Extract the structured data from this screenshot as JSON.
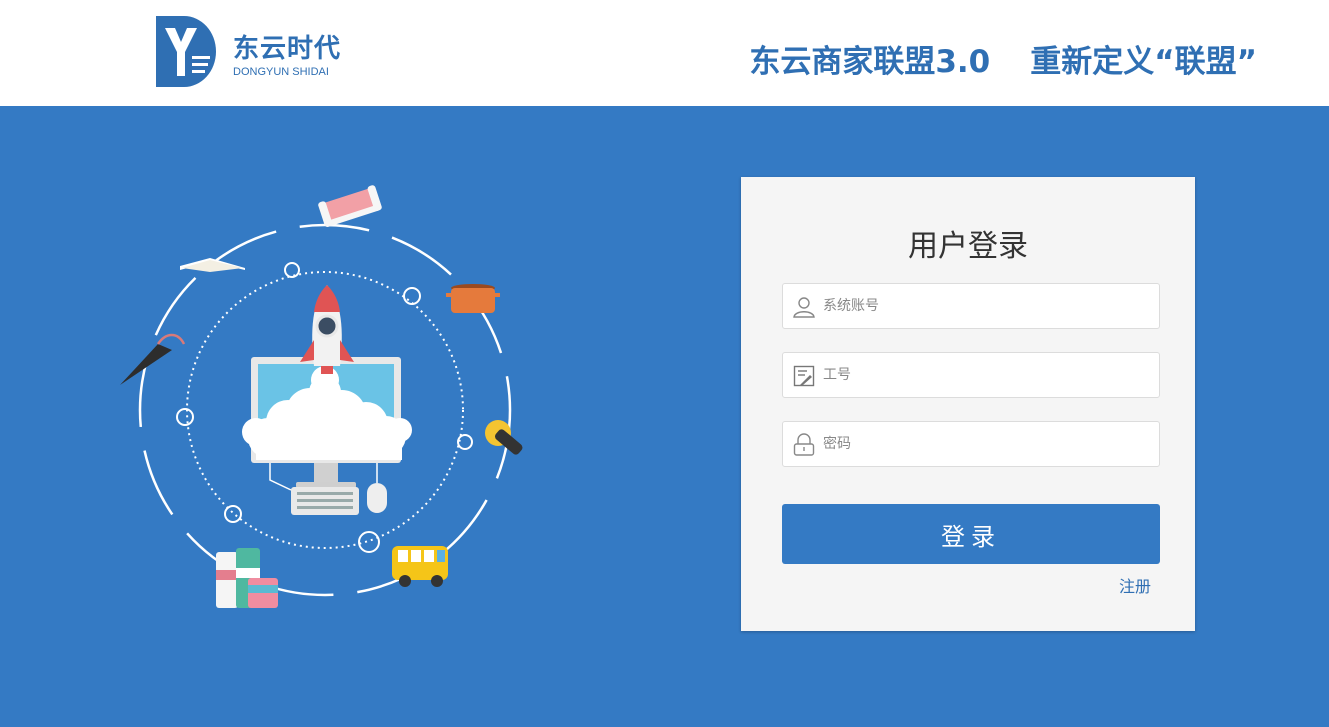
{
  "header": {
    "logo_title": "东云时代",
    "logo_subtitle": "DONGYUN SHIDAI",
    "slogan_part1": "东云商家联盟3.0",
    "slogan_part2": "重新定义“联盟”"
  },
  "login": {
    "title": "用户登录",
    "account_placeholder": "系统账号",
    "employee_id_placeholder": "工号",
    "password_placeholder": "密码",
    "submit_label": "登录",
    "register_label": "注册"
  },
  "colors": {
    "brand_blue": "#347ac4",
    "header_text": "#2f6fb3"
  },
  "icons": [
    "user-icon",
    "edit-icon",
    "lock-icon"
  ]
}
